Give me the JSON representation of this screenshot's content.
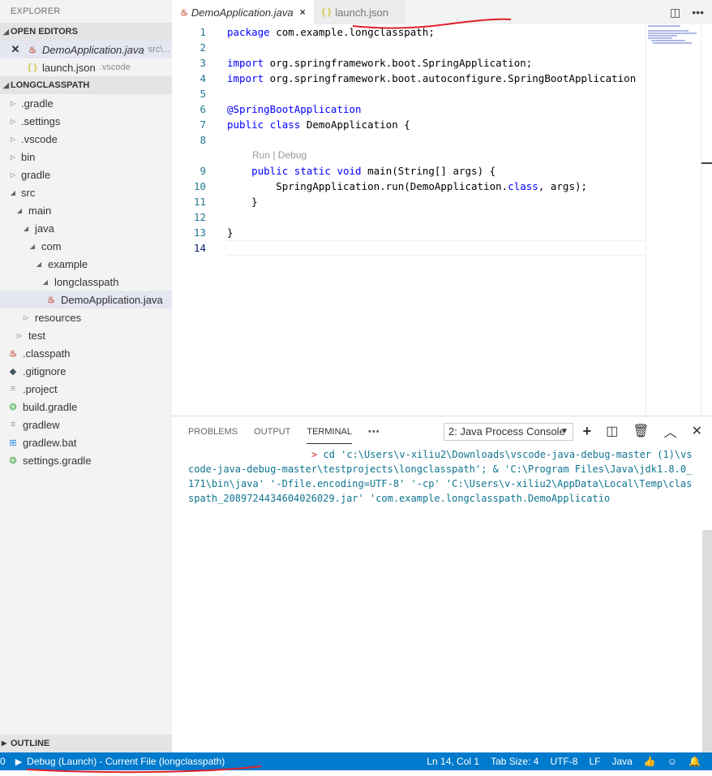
{
  "explorer": {
    "title": "EXPLORER",
    "open_editors_label": "OPEN EDITORS",
    "open_editors": [
      {
        "name": "DemoApplication.java",
        "path": "src\\...",
        "icon": "java-file-icon",
        "active": true
      },
      {
        "name": "launch.json",
        "path": ".vscode",
        "icon": "json-file-icon",
        "active": false
      }
    ],
    "project_label": "LONGCLASSPATH",
    "tree": [
      {
        "label": ".gradle",
        "type": "folder",
        "expanded": false
      },
      {
        "label": ".settings",
        "type": "folder",
        "expanded": false
      },
      {
        "label": ".vscode",
        "type": "folder",
        "expanded": false
      },
      {
        "label": "bin",
        "type": "folder",
        "expanded": false
      },
      {
        "label": "gradle",
        "type": "folder",
        "expanded": false
      },
      {
        "label": "src",
        "type": "folder",
        "expanded": true
      },
      {
        "label": "main",
        "type": "folder",
        "expanded": true
      },
      {
        "label": "java",
        "type": "folder",
        "expanded": true
      },
      {
        "label": "com",
        "type": "folder",
        "expanded": true
      },
      {
        "label": "example",
        "type": "folder",
        "expanded": true
      },
      {
        "label": "longclasspath",
        "type": "folder",
        "expanded": true
      },
      {
        "label": "DemoApplication.java",
        "type": "java"
      },
      {
        "label": "resources",
        "type": "folder",
        "expanded": false
      },
      {
        "label": "test",
        "type": "folder",
        "expanded": false
      },
      {
        "label": ".classpath",
        "type": "java"
      },
      {
        "label": ".gitignore",
        "type": "git"
      },
      {
        "label": ".project",
        "type": "text"
      },
      {
        "label": "build.gradle",
        "type": "gradle"
      },
      {
        "label": "gradlew",
        "type": "text"
      },
      {
        "label": "gradlew.bat",
        "type": "windows"
      },
      {
        "label": "settings.gradle",
        "type": "gradle"
      }
    ],
    "outline_label": "OUTLINE"
  },
  "tabs": [
    {
      "label": "DemoApplication.java",
      "icon": "java-file-icon",
      "active": true,
      "close": "×"
    },
    {
      "label": "launch.json",
      "icon": "json-file-icon",
      "active": false
    }
  ],
  "editor": {
    "line_numbers": [
      "1",
      "2",
      "3",
      "4",
      "5",
      "6",
      "7",
      "8",
      "9",
      "10",
      "11",
      "12",
      "13",
      "14"
    ],
    "codelens": "Run | Debug",
    "code_lines": [
      "package com.example.longclasspath;",
      "",
      "import org.springframework.boot.SpringApplication;",
      "import org.springframework.boot.autoconfigure.SpringBootApplication",
      "",
      "@SpringBootApplication",
      "public class DemoApplication {",
      "",
      "    public static void main(String[] args) {",
      "        SpringApplication.run(DemoApplication.class, args);",
      "    }",
      "",
      "}",
      ""
    ]
  },
  "panel": {
    "tabs": [
      "PROBLEMS",
      "OUTPUT",
      "TERMINAL",
      "•••"
    ],
    "active_tab": "TERMINAL",
    "terminal_select": "2: Java Process Console",
    "terminal_prompt": ">",
    "terminal_text": " cd 'c:\\Users\\v-xiliu2\\Downloads\\vscode-java-debug-master (1)\\vscode-java-debug-master\\testprojects\\longclasspath'; & 'C:\\Program Files\\Java\\jdk1.8.0_171\\bin\\java' '-Dfile.encoding=UTF-8' '-cp' 'C:\\Users\\v-xiliu2\\AppData\\Local\\Temp\\classpath_2089724434604026029.jar' 'com.example.longclasspath.DemoApplicatio"
  },
  "status": {
    "left_count": "0",
    "debug_label": "Debug (Launch) - Current File (longclasspath)",
    "position": "Ln 14, Col 1",
    "tab_size": "Tab Size: 4",
    "encoding": "UTF-8",
    "eol": "LF",
    "language": "Java",
    "bg_color": "#007acc"
  }
}
